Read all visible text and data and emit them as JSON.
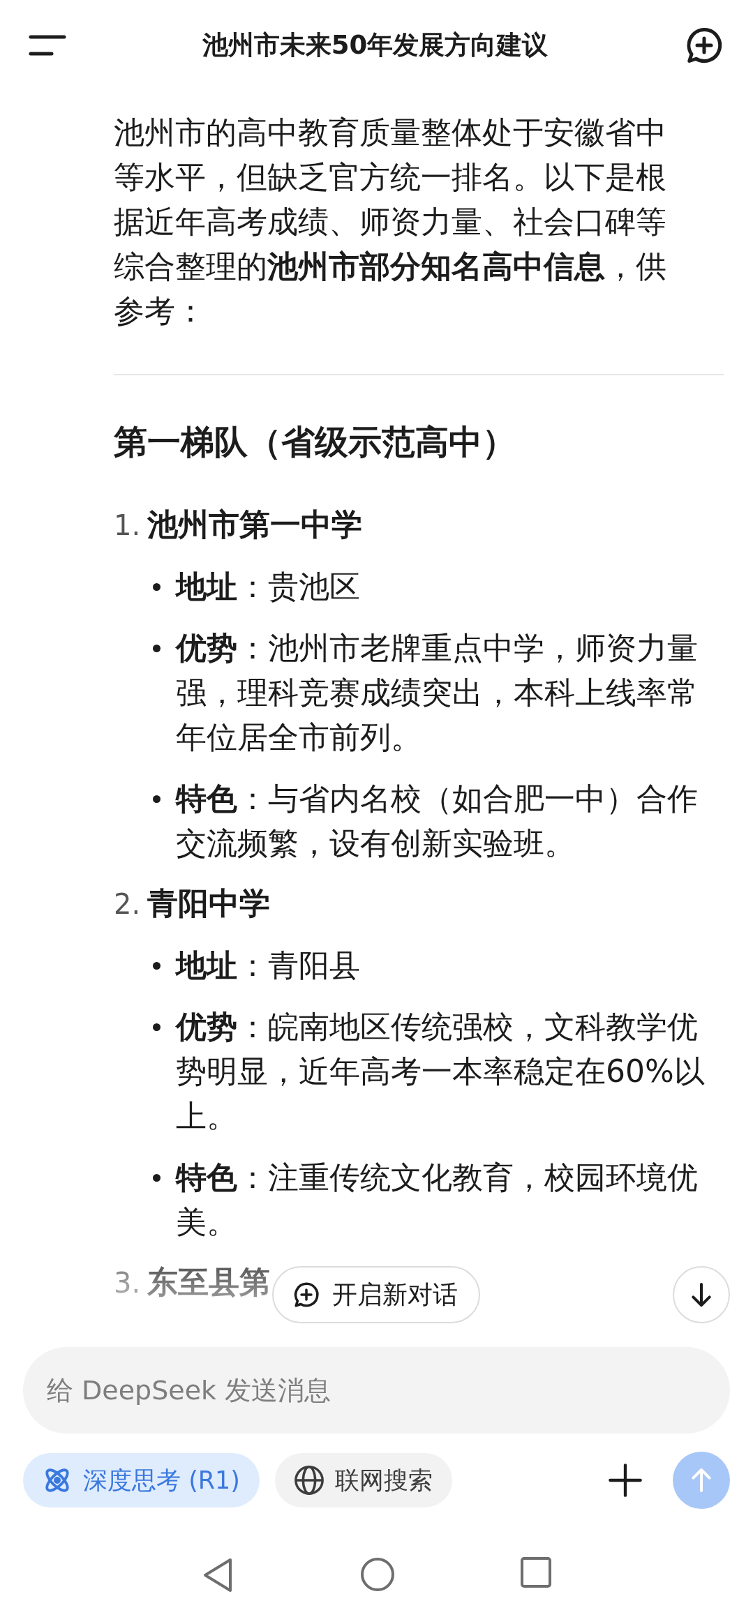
{
  "header": {
    "title": "池州市未来50年发展方向建议"
  },
  "intro": "池州市的高中教育质量整体处于安徽省中等水平，但缺乏官方统一排名。以下是根据近年高考成绩、师资力量、社会口碑等综合整理的**池州市部分知名高中信息**，供参考：",
  "section_heading": "第一梯队（省级示范高中）",
  "schools": [
    {
      "number": "1.",
      "name": "池州市第一中学",
      "details": [
        "**地址**：贵池区",
        "**优势**：池州市老牌重点中学，师资力量强，理科竞赛成绩突出，本科上线率常年位居全市前列。",
        "**特色**：与省内名校（如合肥一中）合作交流频繁，设有创新实验班。"
      ]
    },
    {
      "number": "2.",
      "name": "青阳中学",
      "details": [
        "**地址**：青阳县",
        "**优势**：皖南地区传统强校，文科教学优势明显，近年高考一本率稳定在60%以上。",
        "**特色**：注重传统文化教育，校园环境优美。"
      ]
    },
    {
      "number": "3.",
      "name": "东至县第"
    }
  ],
  "floating_button": {
    "label": "开启新对话"
  },
  "composer": {
    "placeholder": "给 DeepSeek 发送消息",
    "toggles": [
      {
        "label": "深度思考 (R1)",
        "selected": true
      },
      {
        "label": "联网搜索",
        "selected": false
      }
    ]
  }
}
